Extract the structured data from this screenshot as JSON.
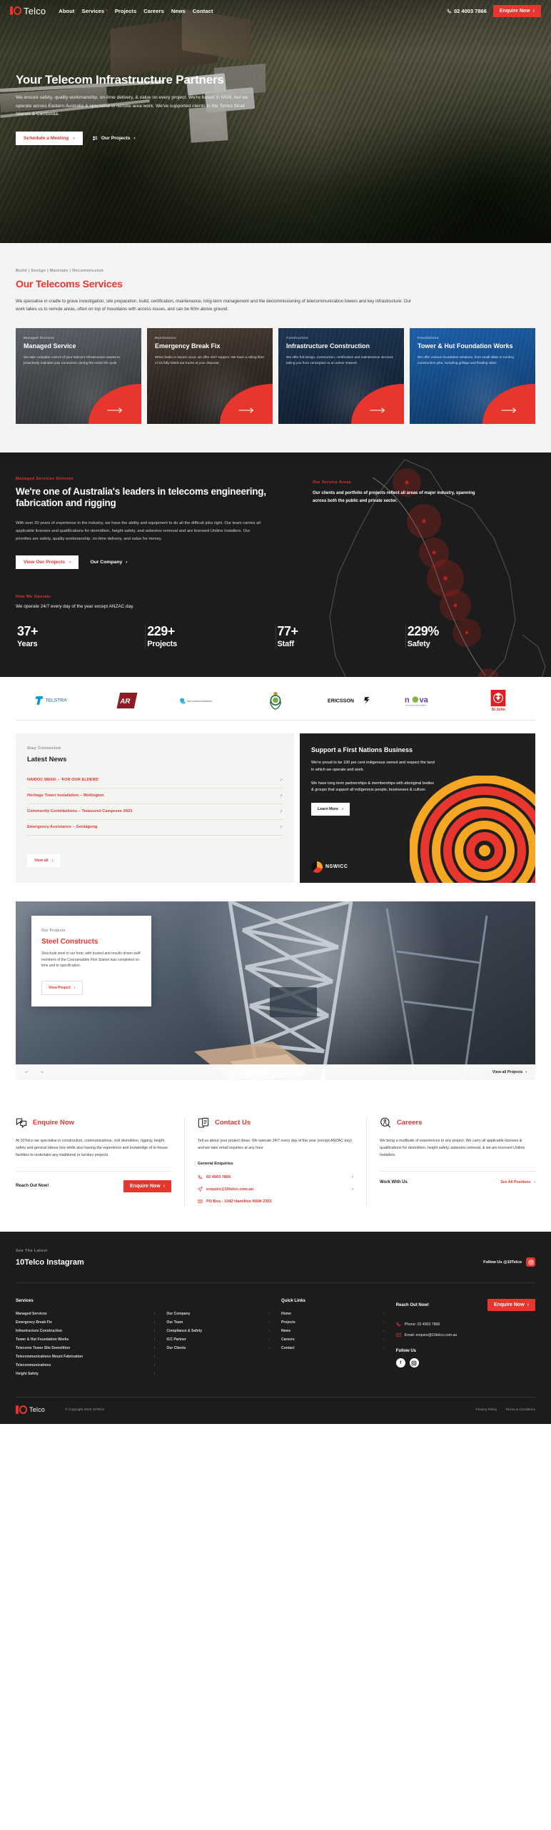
{
  "brand": {
    "name": "10Telco",
    "accent": "#e8352e",
    "dark": "#1c1c1c",
    "light": "#f4f4f2"
  },
  "header": {
    "logo_text": "Telco",
    "nav": [
      {
        "label": "About",
        "has_dropdown": false
      },
      {
        "label": "Services",
        "has_dropdown": true
      },
      {
        "label": "Projects",
        "has_dropdown": false
      },
      {
        "label": "Careers",
        "has_dropdown": false
      },
      {
        "label": "News",
        "has_dropdown": false
      },
      {
        "label": "Contact",
        "has_dropdown": false
      }
    ],
    "phone": "02 4003 7866",
    "cta_label": "Enquire Now"
  },
  "hero": {
    "title": "Your Telecom Infrastructure Partners",
    "body": "We ensure safety, quality workmanship, on-time delivery, & value on every project. We're based in NSW, but we operate across Eastern Australia & specialise in remote area work. We've supported clients in the Torres Strait Islands & Cambodia.",
    "primary_btn": "Schedule a Meeting",
    "secondary_btn": "Our Projects"
  },
  "services": {
    "eyebrow": "Build | Design | Maintain | Decommission",
    "heading": "Our Telecoms Services",
    "lead": "We specialise in cradle to grave investigation, site preparation, build, certification, maintenance, long-term management and the decommissioning of telecommunication towers and key infrastructure. Our work takes us to remote areas, often on top of mountains with access issues, and can be 60m above ground.",
    "cards": [
      {
        "eyebrow": "Managed Services",
        "title": "Managed Service",
        "desc": "We take complete control of your telecom infrastructure assets to proactively maintain your connection during the entire life cycle."
      },
      {
        "eyebrow": "Maintenance",
        "title": "Emergency Break Fix",
        "desc": "When faults or issues occur, we offer 24/7 support. We have a rolling fleet of six fully-kitted-out trucks at your disposal."
      },
      {
        "eyebrow": "Construction",
        "title": "Infrastructure Construction",
        "desc": "We offer full design, construction, certification and maintenance services taking you from conception to an active network."
      },
      {
        "eyebrow": "Foundations",
        "title": "Tower & Hut Foundation Works",
        "desc": "We offer various foundation solutions, from small slabs to turnkey construction jobs, including grillage and floating slabs."
      }
    ]
  },
  "leaders": {
    "eyebrow": "Managed Services Division",
    "heading": "We're one of Australia's leaders in telecoms engineering, fabrication and rigging",
    "body": "With over 20 years of experience in the industry, we have the ability and equipment to do all the difficult jobs right. Our team carries all applicable licenses and qualifications for demolition, height safety, and asbestos removal and are licensed Uniline Installers. Our priorities are safety, quality workmanship, on-time delivery, and value for money.",
    "primary_btn": "View Our Projects",
    "secondary_btn": "Our Company",
    "service_areas_eyebrow": "Our Service Areas",
    "service_areas_body": "Our clients and portfolio of projects reflect all areas of major industry, spanning across both the public and private sector."
  },
  "operate": {
    "eyebrow": "How We Operate",
    "body": "We operate 24/7 every day of the year except ANZAC day.",
    "stats": [
      {
        "number": "37+",
        "label": "Years"
      },
      {
        "number": "229+",
        "label": "Projects"
      },
      {
        "number": "77+",
        "label": "Staff"
      },
      {
        "number": "229%",
        "label": "Safety"
      }
    ]
  },
  "partners": {
    "logos": [
      "Telstra",
      "AR",
      "bai communications",
      "NSW Government Crest",
      "ERICSSON",
      "nova for women and children",
      "St John"
    ]
  },
  "news": {
    "eyebrow": "Stay Connected",
    "heading": "Latest News",
    "items": [
      "NAIDOC WEEK – 'FOR OUR ELDERS'",
      "Heritage Tower Installation – Wellington",
      "Community Contributions – Treasured Camporee 2023",
      "Emergency Assistance – Goolagong"
    ],
    "view_all": "View all"
  },
  "nswicc": {
    "heading": "Support a First Nations Business",
    "p1": "We're proud to be 100 per cent indigenous owned and respect the land in which we operate and work.",
    "p2": "We have long term partnerships & memberships with aboriginal bodies & groups that support all indigenous people, businesses & culture.",
    "learn_more": "Learn More",
    "logo_text": "NSWICC"
  },
  "project_slider": {
    "eyebrow": "Our Projects",
    "title": "Steel Constructs",
    "desc": "Structural steel in our forte, with trusted and results driven staff members of the Coonamabble First Station was completed on time and to specification.",
    "view_project": "View Project",
    "view_all": "View all Projects",
    "prev_icon": "arrow-left-icon",
    "next_icon": "arrow-right-icon"
  },
  "cta": {
    "columns": [
      {
        "icon": "chat-bubbles-icon",
        "title": "Enquire Now",
        "body": "At 10Telco we specialise in construction, communications, civil demolition, rigging, height safety and general labour hire while also having the experience and knowledge of in-house facilities to undertake any traditional or turnkey projects.",
        "foot_label": "Reach Out Now!",
        "foot_btn": "Enquire Now",
        "foot_btn_style": "solid"
      },
      {
        "icon": "mobile-document-icon",
        "title": "Contact Us",
        "body": "Tell us about your project ideas. We operate 24/7 every day of the year (except ANZAC day) and we take email inquiries at any hour.",
        "sub_heading": "General Enquiries",
        "contacts": [
          {
            "icon": "phone-icon",
            "text": "02 4003 7866",
            "has_arrow": true
          },
          {
            "icon": "send-icon",
            "text": "enquire@10telco.com.au",
            "has_arrow": true
          },
          {
            "icon": "mailbox-icon",
            "text": "PO Box - 1042 Hamilton NSW 2303",
            "has_arrow": false
          }
        ]
      },
      {
        "icon": "person-search-icon",
        "title": "Careers",
        "body": "We bring a multitude of experiences to any project. We carry all applicable licenses & qualifications for demolition, height safety, asbestos removal, & we are licensed Uniline Installers.",
        "foot_label": "Work With Us",
        "foot_btn": "See All Positions",
        "foot_btn_style": "link"
      }
    ]
  },
  "footer": {
    "insta_eyebrow": "See The Latest",
    "insta_title": "10Telco Instagram",
    "insta_follow": "Follow Us @10Telco",
    "columns": [
      {
        "heading": "Services",
        "links": [
          "Managed Services",
          "Emergency Break Fix",
          "Infrastructure Construction",
          "Tower & Hut Foundation Works",
          "Telecoms Tower Site Demolition",
          "Telecommunications Mount Fabrication",
          "Telecommunications",
          "Height Safety"
        ]
      },
      {
        "heading": "",
        "links": [
          "Our Company",
          "Our Team",
          "Compliance & Safety",
          "ICC Partner",
          "Our Clients"
        ]
      },
      {
        "heading": "Quick Links",
        "links": [
          "Home",
          "Projects",
          "News",
          "Careers",
          "Contact"
        ]
      }
    ],
    "reach_out_label": "Reach Out Now!",
    "reach_out_btn": "Enquire Now",
    "phone_line": "Phone: 02 4003 7866",
    "email_line": "Email: enquire@10telco.com.au",
    "follow_label": "Follow Us",
    "socials": [
      "facebook",
      "instagram"
    ],
    "copyright": "© Copyright 2023 10Telco",
    "legal": [
      "Privacy Policy",
      "Terms & Conditions"
    ]
  }
}
